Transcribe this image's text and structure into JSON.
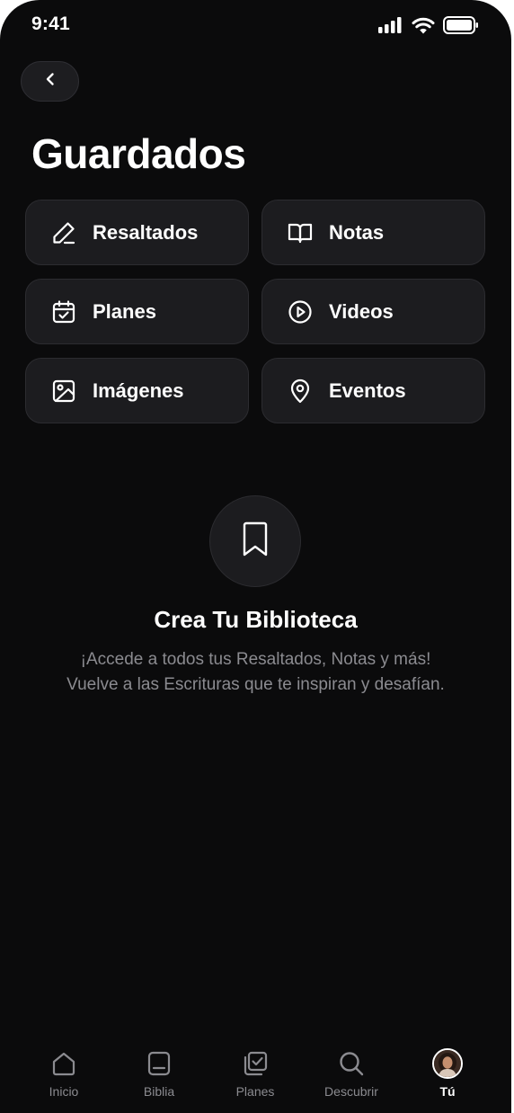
{
  "status_bar": {
    "time": "9:41"
  },
  "header": {
    "back_icon": "chevron-left-icon",
    "title": "Guardados"
  },
  "categories": [
    {
      "label": "Resaltados",
      "icon": "pencil-icon"
    },
    {
      "label": "Notas",
      "icon": "book-open-icon"
    },
    {
      "label": "Planes",
      "icon": "calendar-check-icon"
    },
    {
      "label": "Videos",
      "icon": "play-circle-icon"
    },
    {
      "label": "Imágenes",
      "icon": "image-icon"
    },
    {
      "label": "Eventos",
      "icon": "map-pin-icon"
    }
  ],
  "empty_state": {
    "icon": "bookmark-icon",
    "title": "Crea Tu Biblioteca",
    "description": "¡Accede a todos tus Resaltados, Notas y más! Vuelve a las Escrituras que te inspiran y desafían."
  },
  "tab_bar": {
    "items": [
      {
        "label": "Inicio",
        "icon": "home-icon",
        "active": false
      },
      {
        "label": "Biblia",
        "icon": "bible-icon",
        "active": false
      },
      {
        "label": "Planes",
        "icon": "plans-check-icon",
        "active": false
      },
      {
        "label": "Descubrir",
        "icon": "search-icon",
        "active": false
      },
      {
        "label": "Tú",
        "icon": "avatar",
        "active": true
      }
    ]
  },
  "colors": {
    "background": "#0b0b0c",
    "tile": "#1c1c1f",
    "tile_border": "#2c2c30",
    "muted_text": "#8b8b90",
    "text": "#ffffff"
  }
}
